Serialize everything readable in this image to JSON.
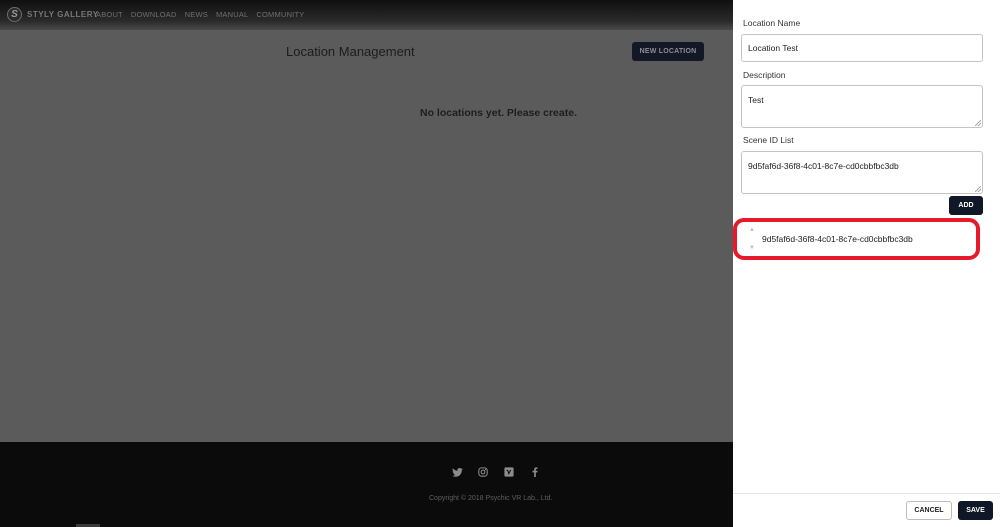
{
  "navbar": {
    "brand_mark": "S",
    "brand_text": "STYLY GALLERY",
    "links": [
      "ABOUT",
      "DOWNLOAD",
      "NEWS",
      "MANUAL",
      "COMMUNITY"
    ]
  },
  "main": {
    "title": "Location Management",
    "new_location_label": "NEW LOCATION",
    "empty_message": "No locations yet. Please create."
  },
  "footer": {
    "social_icons": [
      "twitter-icon",
      "instagram-icon",
      "vimeo-icon",
      "facebook-icon"
    ],
    "copyright": "Copyright © 2018 Psychic VR Lab., Ltd."
  },
  "panel": {
    "location_name": {
      "label": "Location Name",
      "value": "Location Test"
    },
    "description": {
      "label": "Description",
      "value": "Test"
    },
    "scene_id_list": {
      "label": "Scene ID List",
      "value": "9d5faf6d-36f8-4c01-8c7e-cd0cbbfbc3db",
      "add_label": "ADD",
      "items": [
        "9d5faf6d-36f8-4c01-8c7e-cd0cbbfbc3db"
      ],
      "highlight_color": "#e51a2a"
    },
    "cancel_label": "CANCEL",
    "save_label": "SAVE"
  },
  "colors": {
    "overlay_bg": "#5b5b5b",
    "dark_button": "#101726",
    "footer_bg": "#0b0b0b"
  }
}
